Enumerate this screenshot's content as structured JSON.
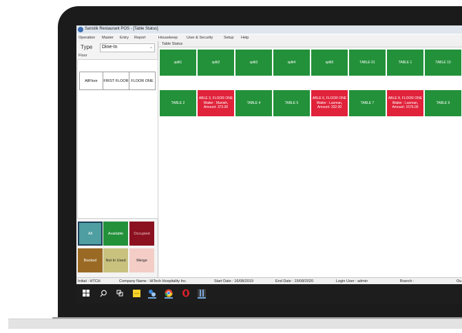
{
  "window": {
    "title": "Sanstik Restaurant POS - [Table Status]"
  },
  "menu": [
    "Operation",
    "Master",
    "Entry",
    "Report",
    "Housekeep",
    "User & Security",
    "Setup",
    "Help"
  ],
  "type_selector": {
    "label": "Type",
    "value": "Dine-In"
  },
  "floor": {
    "label": "Floor",
    "buttons": [
      "AllFloor",
      "FIRST FLOOR",
      "FLOOR ONE"
    ]
  },
  "legend": {
    "row1": [
      {
        "label": "All",
        "color": "#4f9ea1"
      },
      {
        "label": "Available",
        "color": "#23913a"
      },
      {
        "label": "Occupied",
        "color": "#8b1020"
      }
    ],
    "row2": [
      {
        "label": "Booked",
        "color": "#9a6a24"
      },
      {
        "label": "Not In Used",
        "color": "#c9c27e"
      },
      {
        "label": "Merge",
        "color": "#f3cdc6"
      }
    ]
  },
  "table_status": {
    "label": "Table Status",
    "row1": [
      {
        "text": "split1",
        "status": "green"
      },
      {
        "text": "split2",
        "status": "green"
      },
      {
        "text": "split3",
        "status": "green"
      },
      {
        "text": "split4",
        "status": "green"
      },
      {
        "text": "split5",
        "status": "green"
      },
      {
        "text": "TABLE 01",
        "status": "green"
      },
      {
        "text": "TABLE 1",
        "status": "green"
      },
      {
        "text": "TABLE 10",
        "status": "green"
      }
    ],
    "row2": [
      {
        "text": "TABLE 2",
        "status": "green"
      },
      {
        "text": "ABLE 3, FLOOR ONE\nWaiter : Manish,\nAmount: 373.00",
        "status": "red"
      },
      {
        "text": "TABLE 4",
        "status": "green"
      },
      {
        "text": "TABLE 5",
        "status": "green"
      },
      {
        "text": "ABLE 6, FLOOR ONE\nWaiter : Laxman,\nAmount: 332.00",
        "status": "red"
      },
      {
        "text": "TABLE 7",
        "status": "green"
      },
      {
        "text": "ABLE 8, FLOOR ONE\nWaiter : Laxman,\nAmount: 1576.00",
        "status": "red"
      },
      {
        "text": "TABLE 9",
        "status": "green"
      }
    ]
  },
  "status_bar": {
    "initial": "Initial : HTCH",
    "company": "Company Name : HiTech Hospitality Inc.",
    "start_date": "Start Date : 16/08/2019",
    "end_date": "End Date : 15/08/2020",
    "login_user": "Login User : admin",
    "branch": "Branch :",
    "trailing": "Ou"
  },
  "colors": {
    "available": "#23913a",
    "occupied": "#e0223a",
    "taskbar": "#1d1d1d"
  },
  "taskbar_icons": [
    "windows-icon",
    "search-icon",
    "task-view-icon",
    "sticky-notes-icon",
    "network-icon",
    "chrome-icon",
    "opera-icon",
    "app-icon"
  ]
}
